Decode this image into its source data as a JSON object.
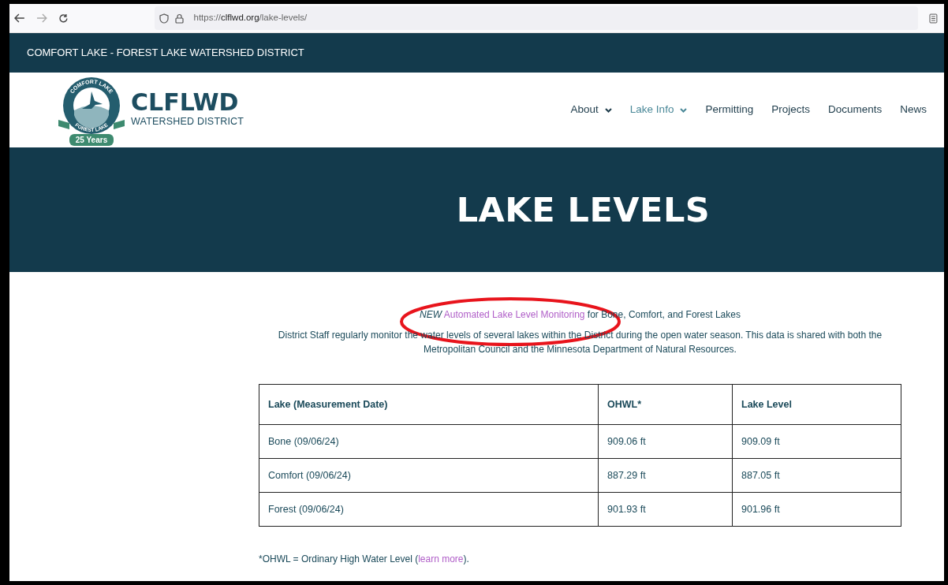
{
  "browser": {
    "url_scheme": "https://",
    "url_domain": "clflwd.org",
    "url_path": "/lake-levels/"
  },
  "topbar": {
    "title": "COMFORT LAKE - FOREST LAKE WATERSHED DISTRICT"
  },
  "logo": {
    "ring_top": "COMFORT LAKE",
    "ring_bottom": "FOREST LAKE",
    "ribbon": "25 Years",
    "name": "CLFLWD",
    "subtitle": "WATERSHED DISTRICT"
  },
  "nav": [
    {
      "label": "About",
      "dropdown": true,
      "selected": false
    },
    {
      "label": "Lake Info",
      "dropdown": true,
      "selected": true
    },
    {
      "label": "Permitting",
      "dropdown": false,
      "selected": false
    },
    {
      "label": "Projects",
      "dropdown": false,
      "selected": false
    },
    {
      "label": "Documents",
      "dropdown": false,
      "selected": false
    },
    {
      "label": "News",
      "dropdown": false,
      "selected": false
    }
  ],
  "hero": {
    "title": "LAKE LEVELS"
  },
  "announcement": {
    "prefix": "*NEW*",
    "link": "Automated Lake Level Monitoring",
    "suffix": "for Bone, Comfort, and Forest Lakes"
  },
  "intro": "District Staff regularly monitor the water levels of several lakes within the District during the open water season. This data is shared with both the Metropolitan Council and the Minnesota Department of Natural Resources.",
  "table": {
    "columns": [
      "Lake (Measurement Date)",
      "OHWL*",
      "Lake Level"
    ],
    "rows": [
      [
        "Bone (09/06/24)",
        "909.06 ft",
        "909.09 ft"
      ],
      [
        "Comfort (09/06/24)",
        "887.29 ft",
        "887.05 ft"
      ],
      [
        "Forest (09/06/24)",
        "901.93 ft",
        "901.96 ft"
      ]
    ]
  },
  "footnote": {
    "prefix": "*OHWL = Ordinary High Water Level (",
    "link": "learn more",
    "suffix": ")."
  },
  "annotations": [
    {
      "kind": "ellipse"
    }
  ]
}
